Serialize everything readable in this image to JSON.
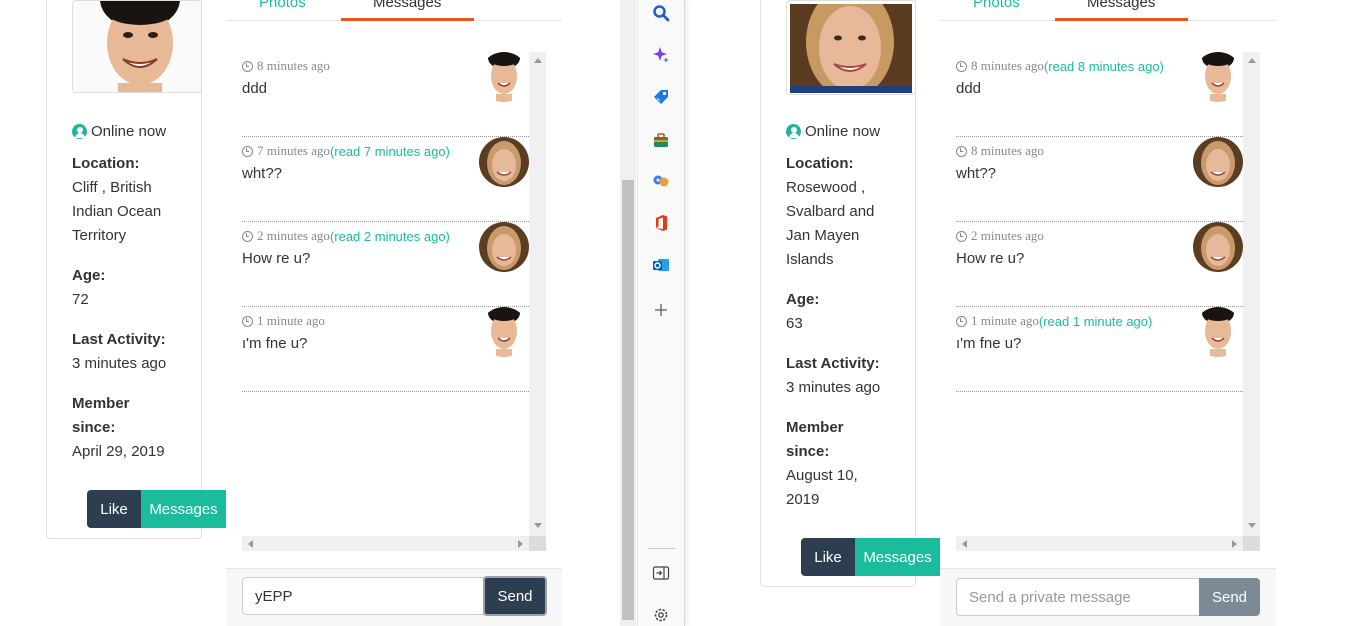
{
  "left_window": {
    "tabs": [
      {
        "label": "Photos"
      },
      {
        "label": "Messages"
      }
    ],
    "profile": {
      "status": "Online now",
      "location_label": "Location:",
      "location_lines": [
        "Cliff , British",
        "Indian Ocean",
        "Territory"
      ],
      "age_label": "Age:",
      "age": "72",
      "last_activity_label": "Last Activity:",
      "last_activity": "3 minutes ago",
      "member_label_1": "Member",
      "member_label_2": "since:",
      "member_since": "April 29, 2019"
    },
    "actions": {
      "like": "Like",
      "messages": "Messages"
    },
    "messages": [
      {
        "time": "8 minutes ago",
        "read": "",
        "text": "ddd",
        "sender": "man"
      },
      {
        "time": "7 minutes ago",
        "read": "(read 7 minutes ago)",
        "text": "wht??",
        "sender": "woman"
      },
      {
        "time": "2 minutes ago",
        "read": "(read 2 minutes ago)",
        "text": "How re u?",
        "sender": "woman"
      },
      {
        "time": "1 minute ago",
        "read": "",
        "text": "ı'm fne u?",
        "sender": "man"
      }
    ],
    "composer": {
      "value": "yEPP",
      "placeholder": "Send a private message",
      "send": "Send"
    }
  },
  "right_window": {
    "tabs": [
      {
        "label": "Photos"
      },
      {
        "label": "Messages"
      }
    ],
    "profile": {
      "status": "Online now",
      "location_label": "Location:",
      "location_lines": [
        "Rosewood ,",
        "Svalbard and",
        "Jan Mayen",
        "Islands"
      ],
      "age_label": "Age:",
      "age": "63",
      "last_activity_label": "Last Activity:",
      "last_activity": "3 minutes ago",
      "member_label_1": "Member",
      "member_label_2": "since:",
      "member_since_lines": [
        "August 10,",
        "2019"
      ]
    },
    "actions": {
      "like": "Like",
      "messages": "Messages"
    },
    "messages": [
      {
        "time": "8 minutes ago",
        "read": "(read 8 minutes ago)",
        "text": "ddd",
        "sender": "man"
      },
      {
        "time": "8 minutes ago",
        "read": "",
        "text": "wht??",
        "sender": "woman"
      },
      {
        "time": "2 minutes ago",
        "read": "",
        "text": "How re u?",
        "sender": "woman"
      },
      {
        "time": "1 minute ago",
        "read": "(read 1 minute ago)",
        "text": "ı'm fne u?",
        "sender": "man"
      }
    ],
    "composer": {
      "value": "",
      "placeholder": "Send a private message",
      "send": "Send"
    }
  },
  "edge_sidebar": {
    "icons": [
      "search-icon",
      "copilot-icon",
      "shopping-tag-icon",
      "toolbox-icon",
      "games-icon",
      "office-icon",
      "outlook-icon",
      "add-icon",
      "split-screen-icon",
      "settings-icon"
    ]
  },
  "colors": {
    "teal": "#1abc9c",
    "dark": "#2c3e50",
    "orange": "#e95420",
    "send_disabled": "#7b8a95"
  }
}
